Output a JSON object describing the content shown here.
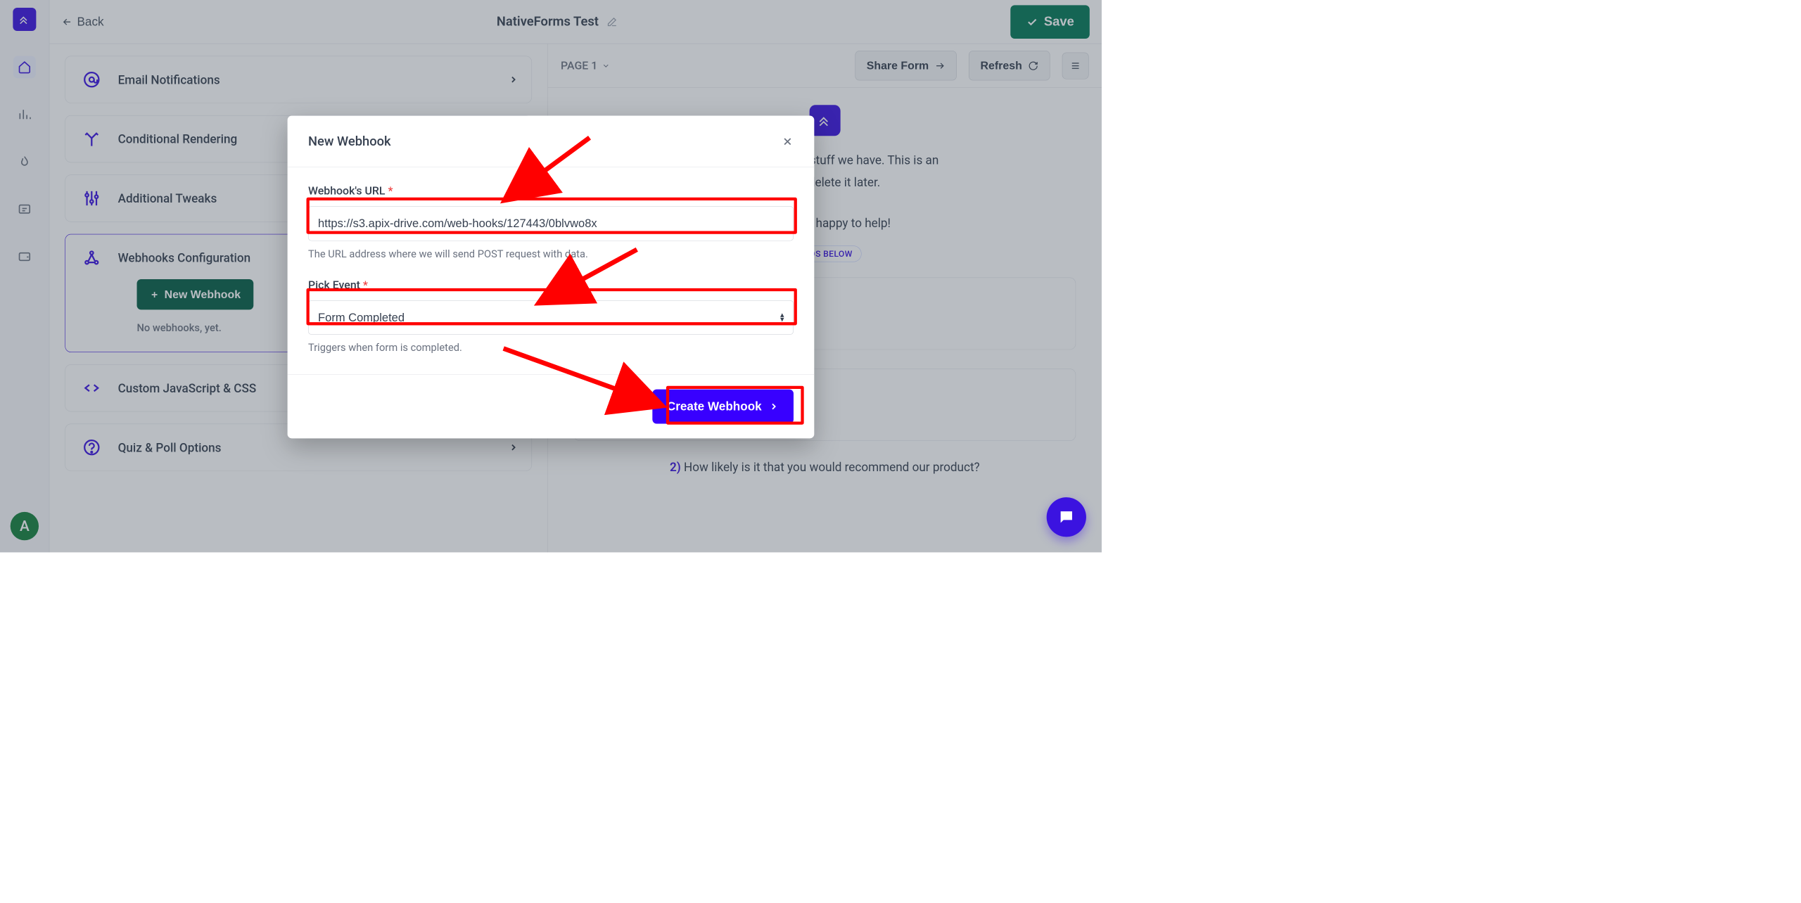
{
  "brand": {
    "accent": "#3b13e0",
    "green": "#047857"
  },
  "rail": {
    "avatar_initial": "A"
  },
  "topbar": {
    "back_label": "Back",
    "title": "NativeForms Test",
    "save_label": "Save"
  },
  "left_pane": {
    "cards": {
      "email": "Email Notifications",
      "conditional": "Conditional Rendering",
      "tweaks": "Additional Tweaks",
      "webhooks_title": "Webhooks Configuration",
      "new_webhook_btn": "New Webhook",
      "no_webhooks": "No webhooks, yet.",
      "custom_js": "Custom JavaScript & CSS",
      "quiz": "Quiz & Poll Options"
    }
  },
  "preview_bar": {
    "page_label": "PAGE 1",
    "share_label": "Share Form",
    "refresh_label": "Refresh"
  },
  "preview_body": {
    "line1": "ough the amazing stuff we have. This is an",
    "line2": "ou can delete it later.",
    "line3_pre": "",
    "line3": "We will be happy to help!",
    "badge": "IELDS BELOW",
    "q2_num": "2)",
    "q2_text": "How likely is it that you would recommend our product?"
  },
  "modal": {
    "title": "New Webhook",
    "url_label": "Webhook's URL",
    "url_value": "https://s3.apix-drive.com/web-hooks/127443/0blvwo8x",
    "url_hint": "The URL address where we will send POST request with data.",
    "event_label": "Pick Event",
    "event_value": "Form Completed",
    "event_hint": "Triggers when form is completed.",
    "create_label": "Create Webhook"
  }
}
